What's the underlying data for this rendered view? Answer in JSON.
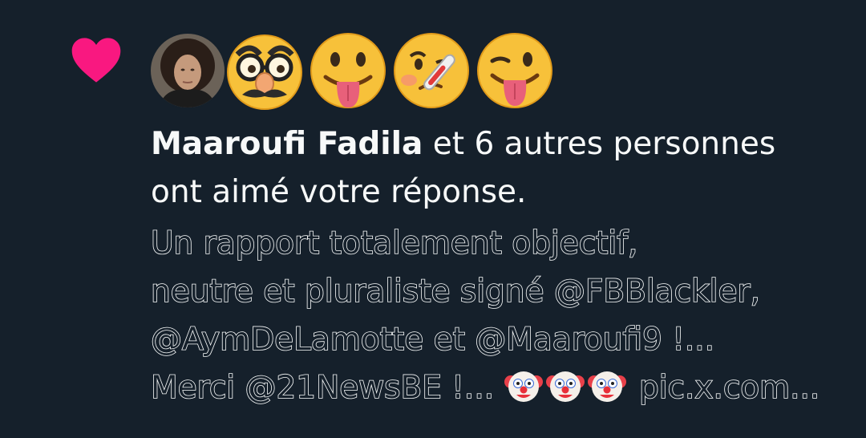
{
  "notification": {
    "type_icon": "heart-icon",
    "accent_color": "#f91880",
    "background_color": "#15202b",
    "avatars": [
      {
        "kind": "photo",
        "label": "profile-photo"
      },
      {
        "kind": "emoji",
        "icon": "disguised-face-emoji"
      },
      {
        "kind": "emoji",
        "icon": "tongue-out-face-emoji"
      },
      {
        "kind": "emoji",
        "icon": "face-with-thermometer-emoji"
      },
      {
        "kind": "emoji",
        "icon": "winking-tongue-face-emoji"
      }
    ],
    "actor_name": "Maaroufi Fadila",
    "summary_rest_line1": " et 6 autres personnes",
    "summary_line2": "ont aimé votre réponse.",
    "tweet": {
      "line1": "Un rapport totalement objectif,",
      "line2": "neutre et pluraliste signé @FBBlackler,",
      "line3": "@AymDeLamotte et @Maaroufi9 !...",
      "line4_start": "Merci @21NewsBE !... ",
      "line4_emojis": [
        "clown-emoji",
        "clown-emoji",
        "clown-emoji"
      ],
      "line4_end": " pic.x.com..."
    }
  }
}
